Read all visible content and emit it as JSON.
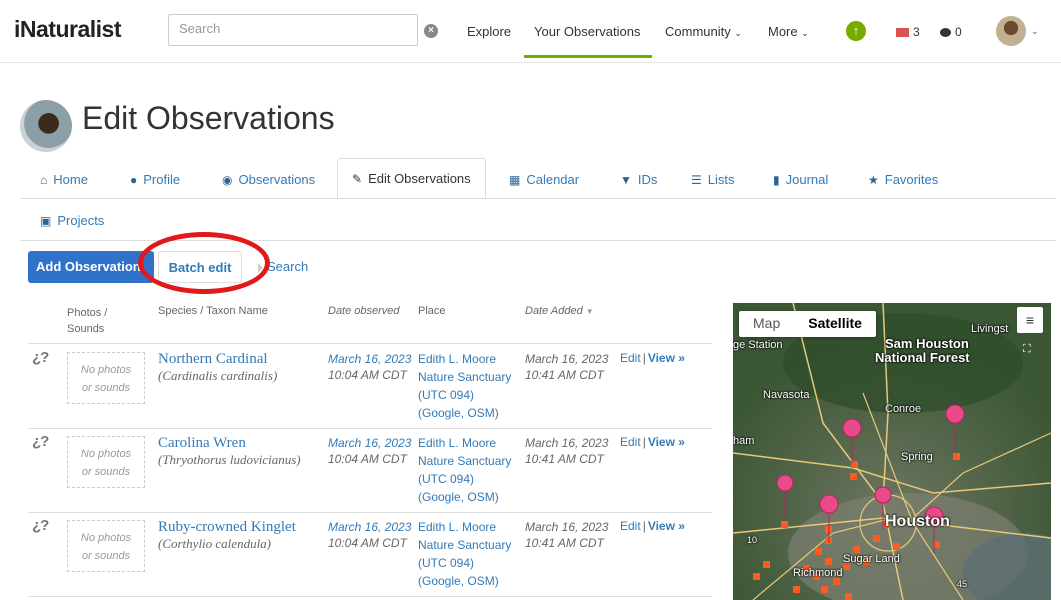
{
  "header": {
    "logo": "iNaturalist",
    "search_placeholder": "Search",
    "nav": [
      "Explore",
      "Your Observations",
      "Community",
      "More"
    ],
    "messages_count": "3",
    "notifications_count": "0"
  },
  "page": {
    "title": "Edit Observations"
  },
  "tabs": [
    {
      "label": "Home",
      "icon": "home-icon"
    },
    {
      "label": "Profile",
      "icon": "user-icon"
    },
    {
      "label": "Observations",
      "icon": "binoculars-icon"
    },
    {
      "label": "Edit Observations",
      "icon": "pencil-icon"
    },
    {
      "label": "Calendar",
      "icon": "calendar-icon"
    },
    {
      "label": "IDs",
      "icon": "tag-icon"
    },
    {
      "label": "Lists",
      "icon": "list-icon"
    },
    {
      "label": "Journal",
      "icon": "book-icon"
    },
    {
      "label": "Favorites",
      "icon": "star-icon"
    },
    {
      "label": "Projects",
      "icon": "briefcase-icon"
    }
  ],
  "actions": {
    "add_label": "Add Observation",
    "batch_label": "Batch edit",
    "search_label": "Search"
  },
  "table": {
    "headers": {
      "photos_line1": "Photos /",
      "photos_line2": "Sounds",
      "species": "Species / Taxon Name",
      "date_observed": "Date observed",
      "place": "Place",
      "date_added": "Date Added"
    },
    "no_photos_line1": "No photos",
    "no_photos_line2": "or sounds",
    "edit_label": "Edit",
    "view_label": "View »",
    "rows": [
      {
        "common": "Northern Cardinal",
        "scientific": "(Cardinalis cardinalis)",
        "obs_date": "March 16, 2023",
        "obs_time": "10:04 AM CDT",
        "place1": "Edith L. Moore",
        "place2": "Nature Sanctuary",
        "place3": "(UTC 094)",
        "place4": "(Google, OSM)",
        "added_date": "March 16, 2023",
        "added_time": "10:41 AM CDT"
      },
      {
        "common": "Carolina Wren",
        "scientific": "(Thryothorus ludovicianus)",
        "obs_date": "March 16, 2023",
        "obs_time": "10:04 AM CDT",
        "place1": "Edith L. Moore",
        "place2": "Nature Sanctuary",
        "place3": "(UTC 094)",
        "place4": "(Google, OSM)",
        "added_date": "March 16, 2023",
        "added_time": "10:41 AM CDT"
      },
      {
        "common": "Ruby-crowned Kinglet",
        "scientific": "(Corthylio calendula)",
        "obs_date": "March 16, 2023",
        "obs_time": "10:04 AM CDT",
        "place1": "Edith L. Moore",
        "place2": "Nature Sanctuary",
        "place3": "(UTC 094)",
        "place4": "(Google, OSM)",
        "added_date": "March 16, 2023",
        "added_time": "10:41 AM CDT"
      }
    ]
  },
  "map": {
    "type_map": "Map",
    "type_satellite": "Satellite",
    "labels": {
      "livingston": "Livingst",
      "station": "ge Station",
      "sam_houston": "Sam Houston",
      "national_forest": "National Forest",
      "navasota": "Navasota",
      "conroe": "Conroe",
      "ham": "ham",
      "spring": "Spring",
      "houston": "Houston",
      "sugar_land": "Sugar Land",
      "richmond": "Richmond",
      "hwy10": "10",
      "hwy45": "45"
    }
  }
}
